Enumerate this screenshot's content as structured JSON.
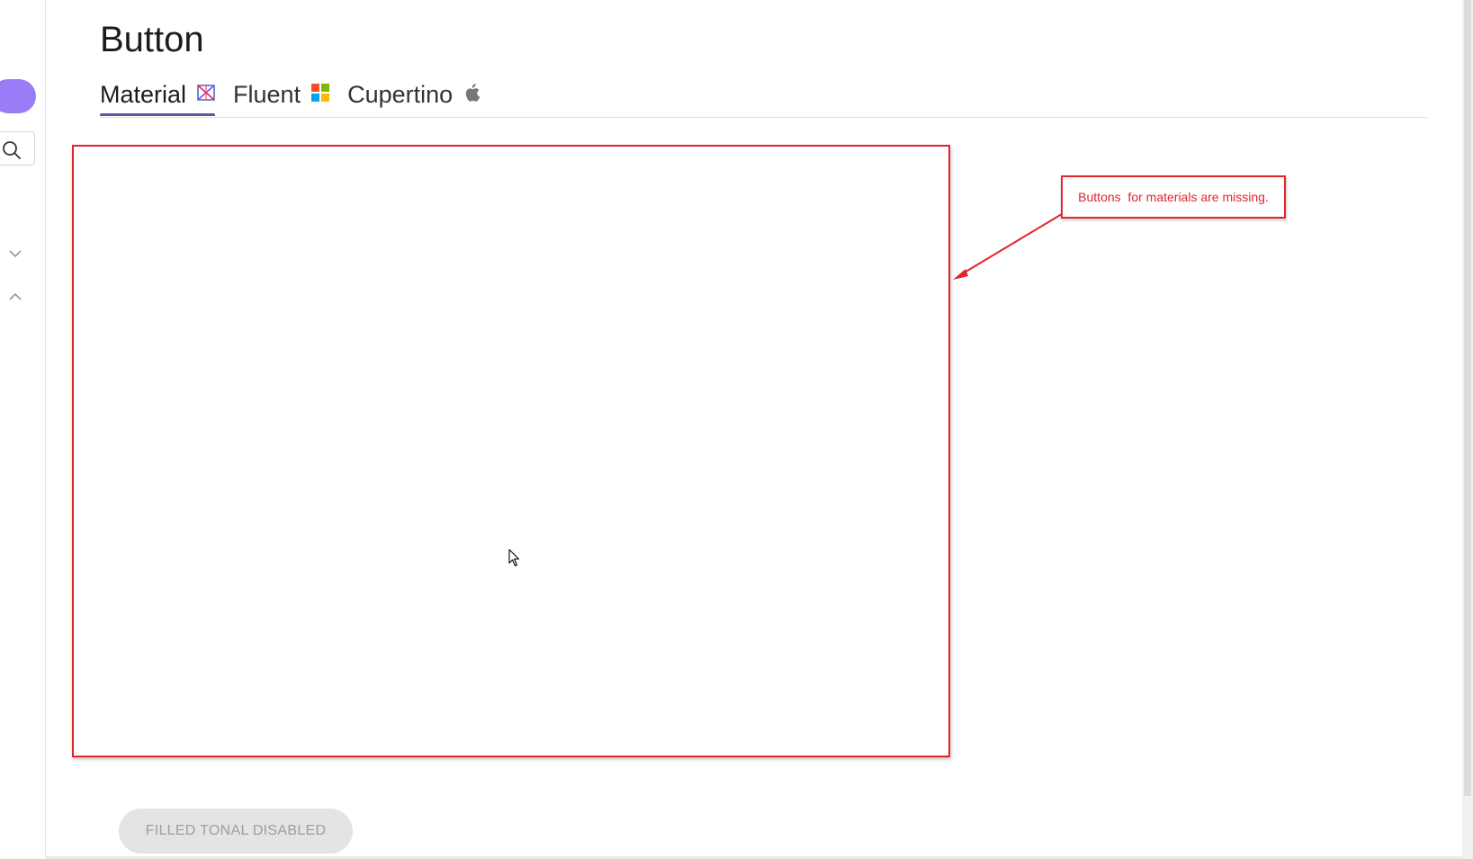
{
  "page": {
    "title": "Button"
  },
  "tabs": [
    {
      "label": "Material",
      "icon": "material-design-icon",
      "active": true
    },
    {
      "label": "Fluent",
      "icon": "microsoft-windows-icon",
      "active": false
    },
    {
      "label": "Cupertino",
      "icon": "apple-icon",
      "active": false
    }
  ],
  "annotation": {
    "callout_text": "Buttons  for materials are missing.",
    "color": "#e3242b"
  },
  "buttons": {
    "filled_tonal_disabled": "FILLED TONAL DISABLED"
  },
  "colors": {
    "accent": "#6750a4",
    "rail_pill": "#9b7cf7",
    "annotation_red": "#e3242b"
  },
  "rail": {
    "icons": [
      "search-icon",
      "chevron-down-icon",
      "chevron-up-icon"
    ]
  }
}
